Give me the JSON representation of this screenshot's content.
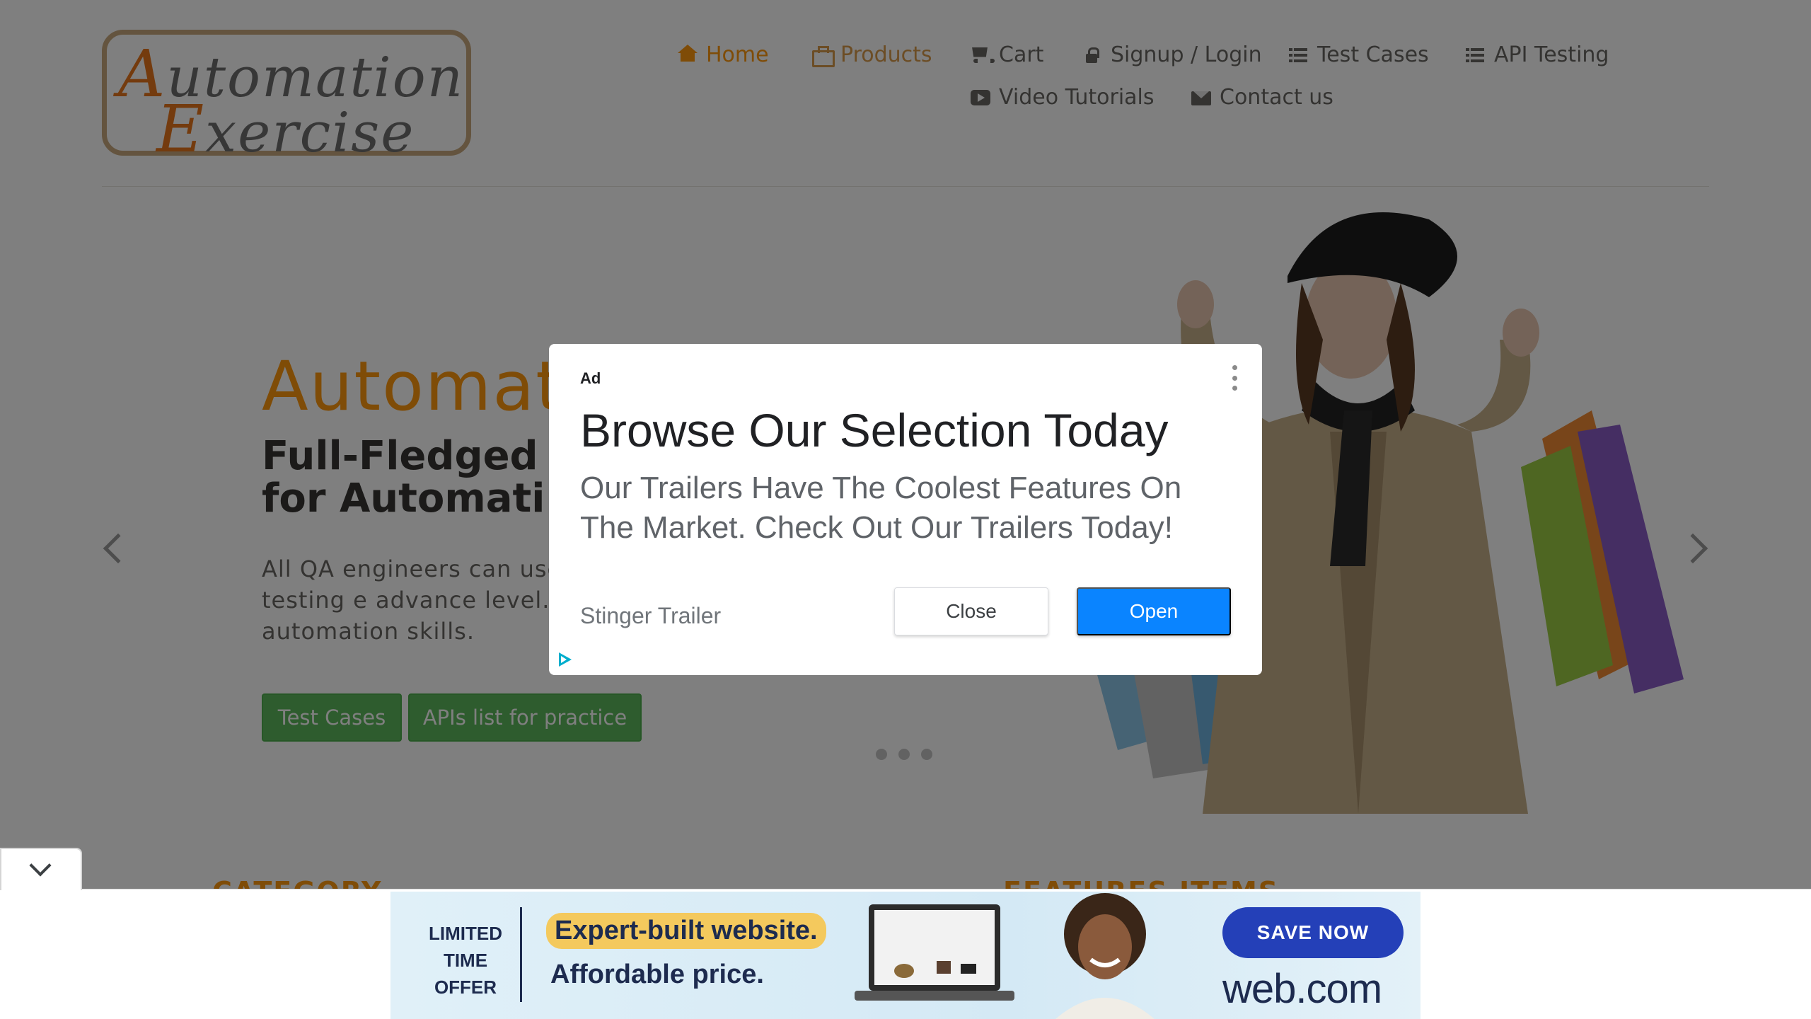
{
  "header": {
    "logo_line1_cap": "A",
    "logo_line1_rest": "utomation",
    "logo_line2_cap": "E",
    "logo_line2_rest": "xercise",
    "nav": [
      {
        "label": "Home",
        "icon": "home-icon",
        "active": true
      },
      {
        "label": "Products",
        "icon": "briefcase-icon",
        "active": false
      },
      {
        "label": "Cart",
        "icon": "shopping-cart-icon",
        "active": false
      },
      {
        "label": "Signup / Login",
        "icon": "lock-icon",
        "active": false
      },
      {
        "label": "Test Cases",
        "icon": "list-icon",
        "active": false
      },
      {
        "label": "API Testing",
        "icon": "list-icon",
        "active": false
      },
      {
        "label": "Video Tutorials",
        "icon": "youtube-play-icon",
        "active": false
      },
      {
        "label": "Contact us",
        "icon": "envelope-icon",
        "active": false
      }
    ]
  },
  "slider": {
    "title": "Automat",
    "subtitle_line1": "Full-Fledged",
    "subtitle_line2": "for Automati",
    "description": "All QA engineers can use practice and API testing e advance level. This is for their automation skills.",
    "btn_test_cases": "Test Cases",
    "btn_apis": "APIs list for practice",
    "slide_count": 3,
    "active_slide": 1
  },
  "sections": {
    "category": "CATEGORY",
    "features": "FEATURES ITEMS"
  },
  "ad": {
    "tag": "Ad",
    "headline": "Browse Our Selection Today",
    "body": "Our Trailers Have The Coolest Features On The Market. Check Out Our Trailers Today!",
    "advertiser": "Stinger Trailer",
    "close_label": "Close",
    "open_label": "Open",
    "open_color": "#0a84ff"
  },
  "banner": {
    "limited": "LIMITED TIME OFFER",
    "headline1": "Expert-built website.",
    "headline2": "Affordable price.",
    "cta": "SAVE NOW",
    "brand": "web.com"
  },
  "colors": {
    "accent": "#fe980f",
    "green": "#5cb85c",
    "overlay": "rgba(0,0,0,0.5)"
  }
}
